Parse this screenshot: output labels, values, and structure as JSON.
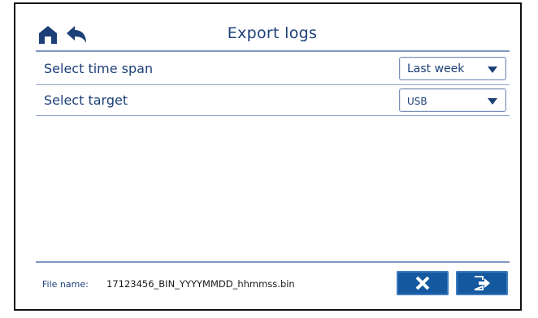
{
  "header": {
    "title": "Export  logs",
    "icons": [
      "home-icon",
      "back-arrow-icon"
    ]
  },
  "rows": [
    {
      "label": "Select time span",
      "value": "Last week"
    },
    {
      "label": "Select target",
      "value": "USB"
    }
  ],
  "footer": {
    "file_label": "File name:",
    "file_name": "17123456_BIN_YYYYMMDD_hhmmss.bin",
    "buttons": [
      "close-icon",
      "export-icon"
    ]
  },
  "colors": {
    "text": "#1d3f78",
    "button": "#14589f",
    "rule": "#7f97c2"
  }
}
